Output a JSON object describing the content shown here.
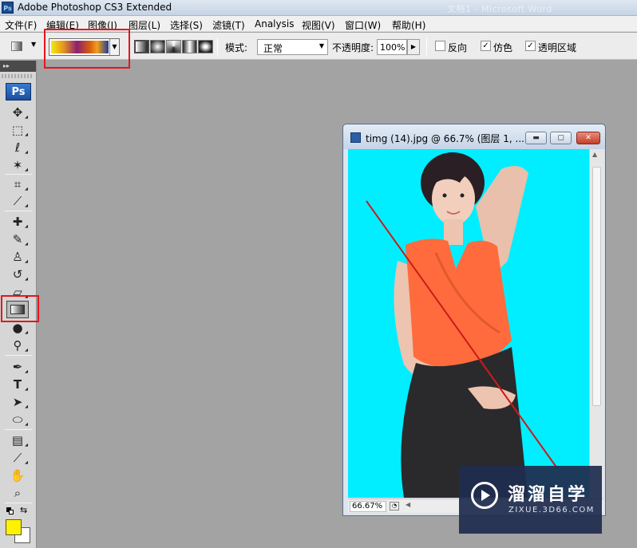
{
  "app": {
    "title": "Adobe Photoshop CS3 Extended",
    "icon_label": "Ps",
    "background_window_title": "文档1 - Microsoft Word"
  },
  "menu": [
    "文件(F)",
    "编辑(E)",
    "图像(I)",
    "图层(L)",
    "选择(S)",
    "滤镜(T)",
    "Analysis",
    "视图(V)",
    "窗口(W)",
    "帮助(H)"
  ],
  "options": {
    "mode_label": "模式:",
    "mode_value": "正常",
    "opacity_label": "不透明度:",
    "opacity_value": "100%",
    "reverse_label": "反向",
    "reverse_checked": false,
    "dither_label": "仿色",
    "dither_checked": true,
    "transparency_label": "透明区域",
    "transparency_checked": true,
    "gradient_colors": [
      "#f4ea10",
      "#e49321",
      "#8d1f73",
      "#d95f0b",
      "#f0a020",
      "#203c92"
    ],
    "gradient_types": [
      "linear",
      "radial",
      "angle",
      "reflected",
      "diamond"
    ]
  },
  "toolbox": {
    "logo": "Ps",
    "tools": [
      "move-tool",
      "marquee-tool",
      "lasso-tool",
      "magic-wand-tool",
      "crop-tool",
      "slice-tool",
      "healing-brush-tool",
      "brush-tool",
      "clone-stamp-tool",
      "history-brush-tool",
      "eraser-tool",
      "gradient-tool",
      "blur-tool",
      "dodge-tool",
      "pen-tool",
      "type-tool",
      "path-selection-tool",
      "shape-tool",
      "notes-tool",
      "eyedropper-tool",
      "hand-tool",
      "zoom-tool"
    ],
    "active_tool": "gradient-tool",
    "foreground_color": "#fff200",
    "background_color": "#ffffff"
  },
  "document": {
    "title": "timg (14).jpg @ 66.7% (图层 1, ...",
    "zoom": "66.67%",
    "canvas_background": "#00eeff"
  },
  "annotations": {
    "highlight_color": "#e5161c",
    "drag_line_color": "#cc1a1a"
  },
  "watermark": {
    "brand": "溜溜自学",
    "url": "ZIXUE.3D66.COM"
  }
}
